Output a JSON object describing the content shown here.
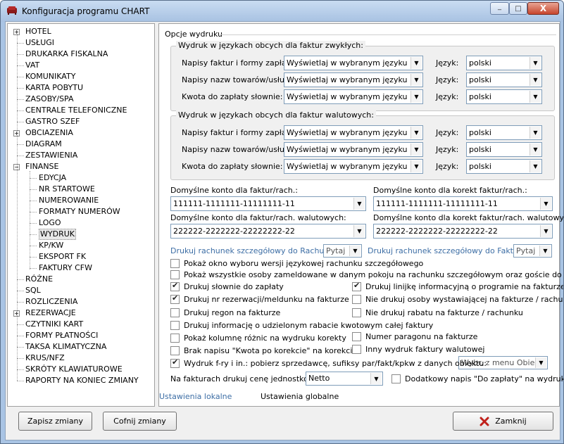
{
  "window": {
    "title": "Konfiguracja programu CHART",
    "controls": [
      "_",
      "□",
      "X"
    ]
  },
  "tree": [
    {
      "label": "HOTEL",
      "level": 0,
      "expandable": true,
      "expanded": false
    },
    {
      "label": "USŁUGI",
      "level": 0
    },
    {
      "label": "DRUKARKA FISKALNA",
      "level": 0
    },
    {
      "label": "VAT",
      "level": 0
    },
    {
      "label": "KOMUNIKATY",
      "level": 0
    },
    {
      "label": "KARTA POBYTU",
      "level": 0
    },
    {
      "label": "ZASOBY/SPA",
      "level": 0
    },
    {
      "label": "CENTRALE TELEFONICZNE",
      "level": 0
    },
    {
      "label": "GASTRO SZEF",
      "level": 0
    },
    {
      "label": "OBCIAZENIA",
      "level": 0,
      "expandable": true,
      "expanded": false
    },
    {
      "label": "DIAGRAM",
      "level": 0
    },
    {
      "label": "ZESTAWIENIA",
      "level": 0
    },
    {
      "label": "FINANSE",
      "level": 0,
      "expandable": true,
      "expanded": true
    },
    {
      "label": "EDYCJA",
      "level": 1
    },
    {
      "label": "NR STARTOWE",
      "level": 1
    },
    {
      "label": "NUMEROWANIE",
      "level": 1
    },
    {
      "label": "FORMATY NUMERÓW",
      "level": 1
    },
    {
      "label": "LOGO",
      "level": 1
    },
    {
      "label": "WYDRUK",
      "level": 1,
      "selected": true
    },
    {
      "label": "KP/KW",
      "level": 1
    },
    {
      "label": "EKSPORT FK",
      "level": 1
    },
    {
      "label": "FAKTURY CFW",
      "level": 1
    },
    {
      "label": "RÓŻNE",
      "level": 0
    },
    {
      "label": "SQL",
      "level": 0
    },
    {
      "label": "ROZLICZENIA",
      "level": 0
    },
    {
      "label": "REZERWACJE",
      "level": 0,
      "expandable": true,
      "expanded": false
    },
    {
      "label": "CZYTNIKI KART",
      "level": 0
    },
    {
      "label": "FORMY PŁATNOŚCI",
      "level": 0
    },
    {
      "label": "TAKSA KLIMATYCZNA",
      "level": 0
    },
    {
      "label": "KRUS/NFZ",
      "level": 0
    },
    {
      "label": "SKRÓTY KLAWIATUROWE",
      "level": 0
    },
    {
      "label": "RAPORTY NA KONIEC ZMIANY",
      "level": 0
    }
  ],
  "print_options": {
    "title": "Opcje wydruku",
    "group1": {
      "title": "Wydruk w językach obcych dla faktur zwykłych:",
      "rows": [
        {
          "label": "Napisy faktur i formy zapłaty:",
          "mode": "Wyświetlaj w wybranym języku",
          "lang_label": "Język:",
          "lang": "polski"
        },
        {
          "label": "Napisy nazw towarów/usług:",
          "mode": "Wyświetlaj w wybranym języku",
          "lang_label": "Język:",
          "lang": "polski"
        },
        {
          "label": "Kwota do zapłaty słownie:",
          "mode": "Wyświetlaj w wybranym języku",
          "lang_label": "Język:",
          "lang": "polski"
        }
      ]
    },
    "group2": {
      "title": "Wydruk w językach obcych dla faktur walutowych:",
      "rows": [
        {
          "label": "Napisy faktur i formy zapłaty:",
          "mode": "Wyświetlaj w wybranym języku",
          "lang_label": "Język:",
          "lang": "polski"
        },
        {
          "label": "Napisy nazw towarów/usług:",
          "mode": "Wyświetlaj w wybranym języku",
          "lang_label": "Język:",
          "lang": "polski"
        },
        {
          "label": "Kwota do zapłaty słownie:",
          "mode": "Wyświetlaj w wybranym języku",
          "lang_label": "Język:",
          "lang": "polski"
        }
      ]
    },
    "accounts": {
      "default_label": "Domyślne konto dla faktur/rach.:",
      "default_value": "111111-1111111-11111111-11",
      "correction_label": "Domyślne konto dla korekt faktur/rach.:",
      "correction_value": "111111-1111111-11111111-11",
      "fx_label": "Domyślne konto dla faktur/rach. walutowych:",
      "fx_value": "222222-2222222-22222222-22",
      "fx_correction_label": "Domyślne konto dla korekt faktur/rach. walutowych:",
      "fx_correction_value": "222222-2222222-22222222-22"
    },
    "detailed": {
      "bill_label": "Drukuj rachunek szczegółowy do Rachunku:",
      "bill_value": "Pytaj",
      "invoice_label": "Drukuj rachunek szczegółowy do Faktury:",
      "invoice_value": "Pytaj"
    },
    "checkboxes": {
      "show_lang_window": {
        "label": "Pokaż okno wyboru wersji językowej rachunku szczegółowego",
        "checked": false
      },
      "show_all_guests": {
        "label": "Pokaż wszystkie osoby zameldowane w danym pokoju na rachunku szczegółowym oraz goście do dok.",
        "checked": false
      },
      "print_words": {
        "label": "Drukuj słownie do zapłaty",
        "checked": true
      },
      "print_info_line": {
        "label": "Drukuj linijkę informacyjną o programie na fakturze",
        "checked": true
      },
      "print_res_no": {
        "label": "Drukuj nr rezerwacji/meldunku na fakturze",
        "checked": true
      },
      "no_issuer": {
        "label": "Nie drukuj osoby wystawiającej na fakturze / rachunku",
        "checked": false
      },
      "print_regon": {
        "label": "Drukuj regon na fakturze",
        "checked": false
      },
      "no_discount": {
        "label": "Nie drukuj rabatu na fakturze / rachunku",
        "checked": false
      },
      "print_discount_info": {
        "label": "Drukuj informację o udzielonym rabacie kwotowym całej faktury",
        "checked": false
      },
      "diff_column": {
        "label": "Pokaż kolumnę różnic na wydruku korekty",
        "checked": false
      },
      "receipt_number": {
        "label": "Numer paragonu na fakturze",
        "checked": false
      },
      "no_after_correction": {
        "label": "Brak napisu \"Kwota po korekcie\" na korekcie",
        "checked": false
      },
      "other_fx_print": {
        "label": "Inny wydruk faktury walutowej",
        "checked": false
      },
      "fry_print": {
        "label": "Wydruk f-ry i in.: pobierz sprzedawcę, sufiksy par/fakt/kpkw z danych obiektu:",
        "checked": true,
        "select": "Wybr. z menu Obiekty"
      },
      "extra_note": {
        "label": "Dodatkowy napis \"Do zapłaty\" na wydruku",
        "checked": false
      }
    },
    "unit_price": {
      "label": "Na fakturach drukuj cenę jednostkową:",
      "value": "Netto"
    }
  },
  "tabs": {
    "local": "Ustawienia lokalne",
    "global": "Ustawienia globalne"
  },
  "buttons": {
    "save": "Zapisz zmiany",
    "revert": "Cofnij zmiany",
    "close": "Zamknij"
  }
}
